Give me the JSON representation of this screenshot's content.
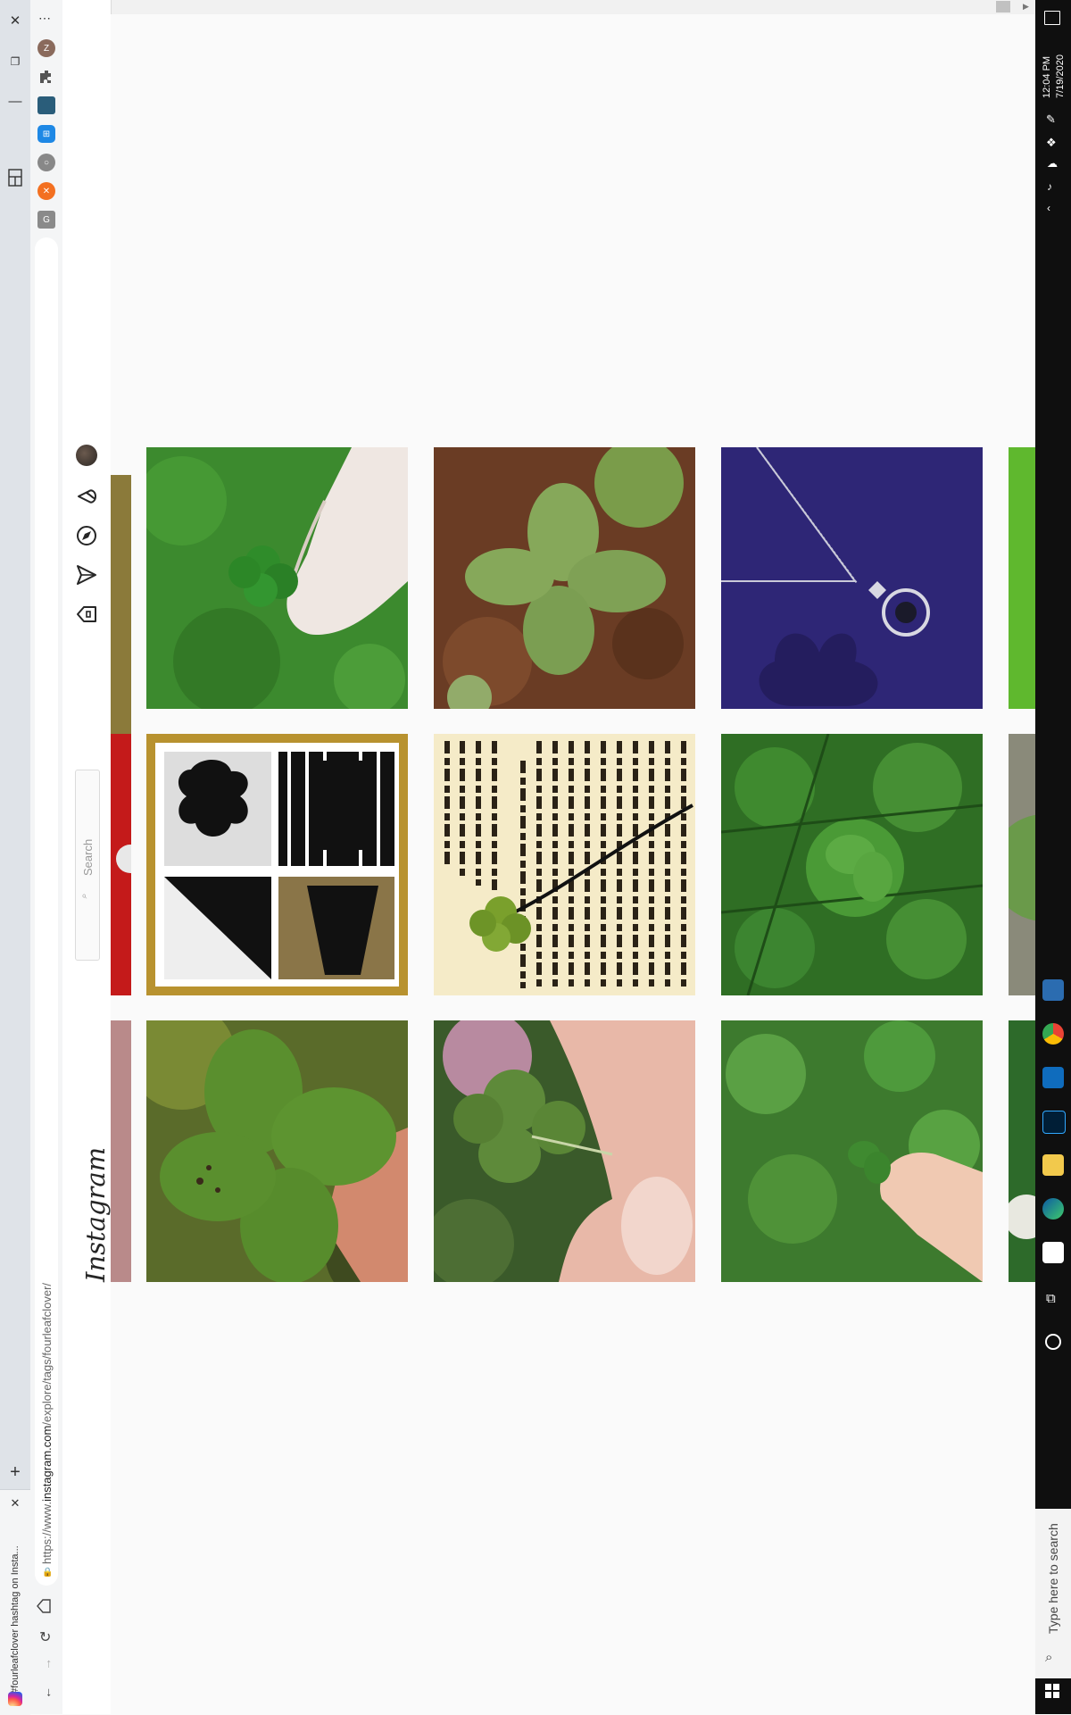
{
  "browser": {
    "tab_title": "#fourleafclover hashtag on Insta...",
    "url_prefix": "https://www.",
    "url_domain": "instagram.com",
    "url_path": "/explore/tags/fourleafclover/"
  },
  "instagram": {
    "logo_text": "Instagram",
    "search_placeholder": "Search"
  },
  "taskbar": {
    "search_placeholder": "Type here to search",
    "time": "12:04 PM",
    "date": "7/19/2020"
  },
  "grid": {
    "rows": [
      [
        "hand-holding-clover-on-grass",
        "clover-on-soil",
        "clover-necklace-on-navy"
      ],
      [
        "lucky-clover-cards",
        "pressed-clover-in-book",
        "clover-patch-in-grass"
      ],
      [
        "four-leaf-clover-closeup",
        "fingers-holding-clover",
        "hand-picking-clover"
      ]
    ]
  },
  "colors": {
    "taskbar_bg": "#0f0f0f",
    "page_bg": "#fafafa",
    "chrome_bg": "#dfe3e8"
  }
}
